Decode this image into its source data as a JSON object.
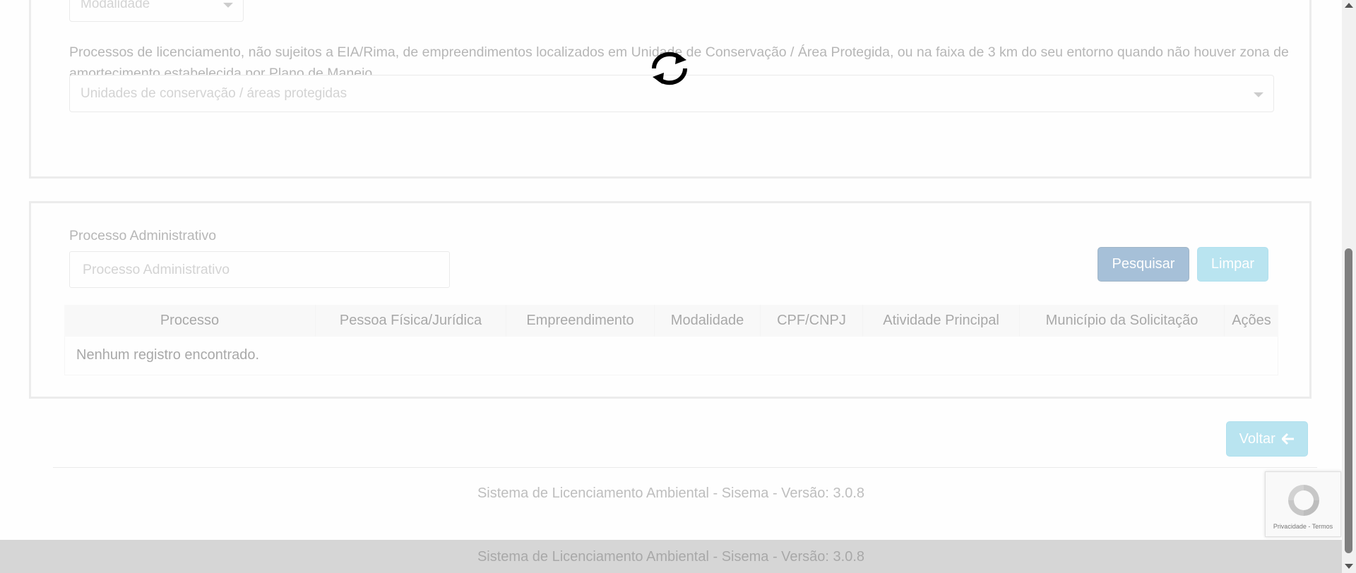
{
  "filters": {
    "modalidade_placeholder": "Modalidade",
    "description": "Processos de licenciamento, não sujeitos a EIA/Rima, de empreendimentos localizados em Unidade de Conservação / Área Protegida, ou na faixa de 3 km do seu entorno quando não houver zona de amortecimento estabelecida por Plano de Manejo",
    "unidades_placeholder": "Unidades de conservação / áreas protegidas"
  },
  "search": {
    "label": "Processo Administrativo",
    "placeholder": "Processo Administrativo",
    "search_button": "Pesquisar",
    "clear_button": "Limpar"
  },
  "table": {
    "columns": [
      "Processo",
      "Pessoa Física/Jurídica",
      "Empreendimento",
      "Modalidade",
      "CPF/CNPJ",
      "Atividade Principal",
      "Município da Solicitação",
      "Ações"
    ],
    "empty_message": "Nenhum registro encontrado."
  },
  "back_button": "Voltar",
  "footer": {
    "text": "Sistema de Licenciamento Ambiental - Sisema - Versão: 3.0.8",
    "bar_text": "Sistema de Licenciamento Ambiental - Sisema - Versão: 3.0.8"
  },
  "recaptcha": {
    "text": "Privacidade - Termos"
  },
  "colors": {
    "primary": "#2e6da4",
    "info": "#5bc0de",
    "overlay": "rgba(255,255,255,0.58)"
  }
}
